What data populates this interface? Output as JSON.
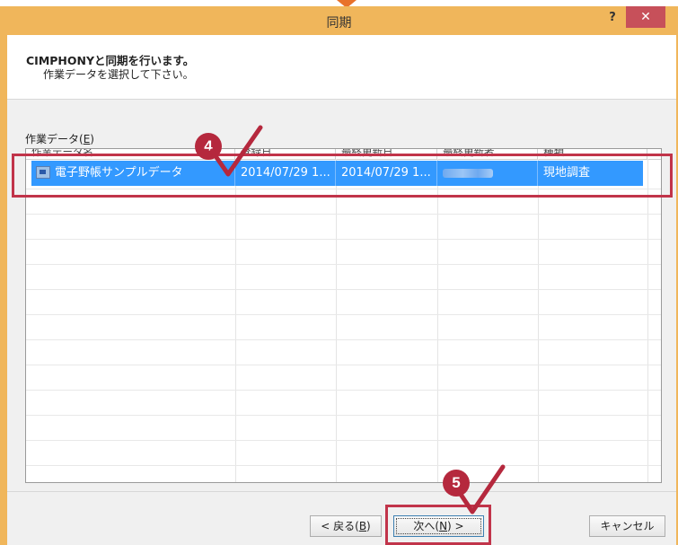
{
  "window": {
    "title": "同期",
    "help_label": "?",
    "close_label": "✕"
  },
  "header": {
    "title": "CIMPHONYと同期を行います。",
    "subtitle": "作業データを選択して下さい。"
  },
  "list": {
    "label_prefix": "作業データ(",
    "label_mnemonic": "E",
    "label_suffix": ")",
    "columns": [
      "作業データ名",
      "登録日",
      "最終更新日",
      "最終更新者",
      "種類"
    ],
    "rows": [
      {
        "name": "電子野帳サンプルデータ",
        "registered": "2014/07/29 1...",
        "updated": "2014/07/29 1...",
        "updated_by": "豊村 昭江",
        "type": "現地調査",
        "selected": true
      }
    ]
  },
  "buttons": {
    "back_prefix": "< 戻る(",
    "back_mnemonic": "B",
    "back_suffix": ")",
    "next_prefix": "次へ(",
    "next_mnemonic": "N",
    "next_suffix": ") >",
    "cancel": "キャンセル"
  },
  "annotations": {
    "step4": "4",
    "step5": "5"
  },
  "colors": {
    "frame": "#f0b65b",
    "selection": "#3399ff",
    "highlight": "#c1344a",
    "close": "#c7505a"
  }
}
